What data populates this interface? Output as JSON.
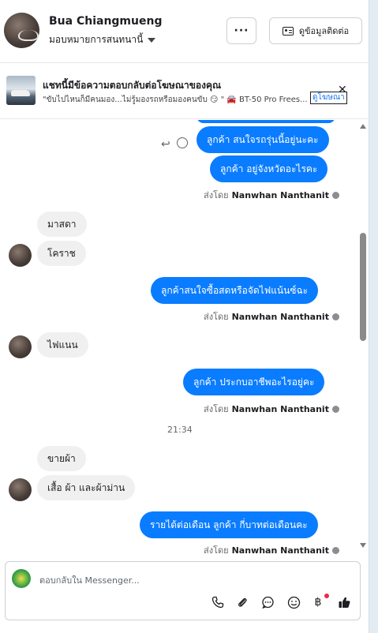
{
  "header": {
    "contact_name": "Bua Chiangmueng",
    "assign_label": "มอบหมายการสนทนานี้",
    "more_label": "···",
    "contact_info_label": "ดูข้อมูลติดต่อ"
  },
  "ad_banner": {
    "title": "แชทนี้มีข้อความตอบกลับต่อโฆษณาของคุณ",
    "subtitle": "\"ขับไปไหนก็มีคนมอง...ไม่รู้มองรถหรือมองคนขับ 😏 \" 🚘 BT-50 Pro Frees...",
    "link_label": "ดูโฆษณา",
    "close_label": "✕"
  },
  "messages": {
    "m1": "ลูกค้า สนใจรถรุ่นนี้อยู่นะคะ",
    "m2": "ลูกค้า อยู่จังหวัดอะไรคะ",
    "sent_prefix": "ส่งโดย",
    "agent_name": "Nanwhan Nanthanit",
    "m3": "มาสดา",
    "m4": "โคราช",
    "m5": "ลูกค้าสนใจซื้อสดหรือจัดไฟแน้นซ์ฉะ",
    "m6": "ไฟแนน",
    "m7": "ลูกค้า ประกบอาชีพอะไรอยู่คะ",
    "time": "21:34",
    "m8": "ขายผ้า",
    "m9": "เสื้อ  ผ้า  และผ้าม่าน",
    "m10": "รายได้ต่อเดือน ลูกค้า กี่บาทต่อเดือนคะ"
  },
  "composer": {
    "placeholder": "ตอบกลับใน Messenger..."
  },
  "icons": {
    "reply": "reply-icon",
    "reaction": "smiley-icon",
    "phone": "phone-icon",
    "attach": "paperclip-icon",
    "saved_reply": "speech-bubble-icon",
    "emoji": "smiley-icon",
    "baht": "baht-icon",
    "like": "thumbs-up-icon"
  },
  "colors": {
    "outgoing_bubble": "#0a7cff",
    "incoming_bubble": "#f0f0f0",
    "link": "#1877f2"
  }
}
